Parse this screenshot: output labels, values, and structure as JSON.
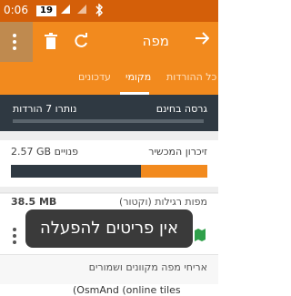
{
  "status_bar": {
    "time": "0:06",
    "battery": "19",
    "signal_icon": "signal-icon",
    "wifi_icon": "wifi-icon",
    "bluetooth_icon": "bluetooth-icon"
  },
  "app_bar": {
    "title": "מפה",
    "menu_icon": "overflow-menu-icon",
    "delete_icon": "trash-icon",
    "refresh_icon": "refresh-icon",
    "back_icon": "arrow-back-icon"
  },
  "tabs": [
    {
      "label": "כל ההורדות"
    },
    {
      "label": "מקומי"
    },
    {
      "label": "עדכונים"
    }
  ],
  "active_tab": "מקומי",
  "storage": {
    "version_label": "גרסה בחינם",
    "remaining_label": "נותרו 7 הורדות",
    "used_fraction": 0.0
  },
  "memory": {
    "title": "זיכרון המכשיר",
    "free_label": "2.57 GB פנויים",
    "used_fraction": 0.66
  },
  "maps": {
    "label": "מפות רגילות (וקטור)",
    "size": "38.5 MB"
  },
  "toast": {
    "message": "אין פריטים להפעלה"
  },
  "section": {
    "header": "אריחי מפה מקוונים ושמורים"
  },
  "partial_row": "(OsmAnd (online tiles"
}
